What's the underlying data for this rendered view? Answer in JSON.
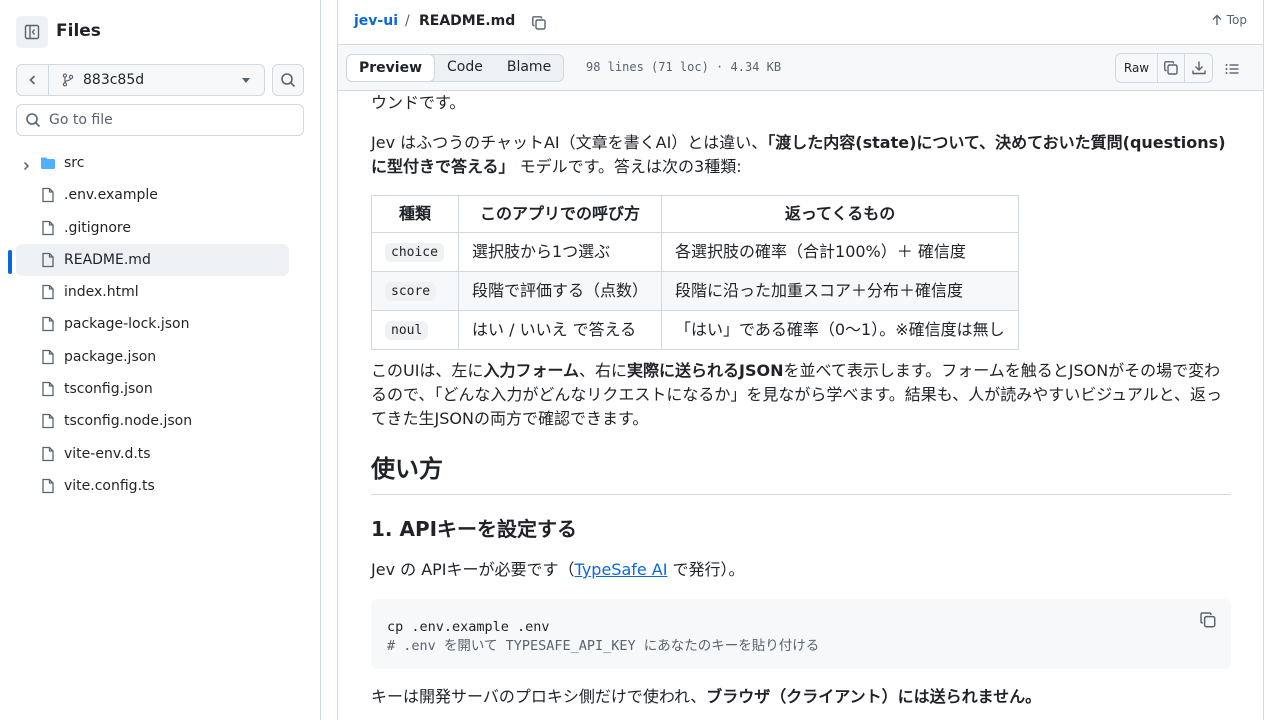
{
  "sidebar": {
    "title": "Files",
    "branch": "883c85d",
    "goto_placeholder": "Go to file",
    "tree": [
      {
        "name": "src",
        "type": "folder"
      },
      {
        "name": ".env.example",
        "type": "file"
      },
      {
        "name": ".gitignore",
        "type": "file"
      },
      {
        "name": "README.md",
        "type": "file",
        "active": true
      },
      {
        "name": "index.html",
        "type": "file"
      },
      {
        "name": "package-lock.json",
        "type": "file"
      },
      {
        "name": "package.json",
        "type": "file"
      },
      {
        "name": "tsconfig.json",
        "type": "file"
      },
      {
        "name": "tsconfig.node.json",
        "type": "file"
      },
      {
        "name": "vite-env.d.ts",
        "type": "file"
      },
      {
        "name": "vite.config.ts",
        "type": "file"
      }
    ]
  },
  "header": {
    "repo": "jev-ui",
    "separator": "/",
    "file": "README.md",
    "top_label": "Top"
  },
  "toolbar": {
    "tabs": [
      "Preview",
      "Code",
      "Blame"
    ],
    "selected_tab": "Preview",
    "meta": "98 lines (71 loc) · 4.34 KB",
    "raw_label": "Raw"
  },
  "readme": {
    "p0": "ウンドです。",
    "p1_a": "Jev はふつうのチャットAI（文章を書くAI）とは違い、",
    "p1_b": "「渡した内容(state)について、決めておいた質問(questions)に型付きで答える」",
    "p1_c": " モデルです。答えは次の3種類:",
    "table": {
      "headers": [
        "種類",
        "このアプリでの呼び方",
        "返ってくるもの"
      ],
      "rows": [
        [
          "choice",
          "選択肢から1つ選ぶ",
          "各選択肢の確率（合計100%）＋ 確信度"
        ],
        [
          "score",
          "段階で評価する（点数）",
          "段階に沿った加重スコア＋分布＋確信度"
        ],
        [
          "noul",
          "はい / いいえ で答える",
          "「はい」である確率（0〜1）。※確信度は無し"
        ]
      ]
    },
    "p2_a": "このUIは、左に",
    "p2_b": "入力フォーム",
    "p2_c": "、右に",
    "p2_d": "実際に送られるJSON",
    "p2_e": "を並べて表示します。フォームを触るとJSONがその場で変わるので、「どんな入力がどんなリクエストになるか」を見ながら学べます。結果も、人が読みやすいビジュアルと、返ってきた生JSONの両方で確認できます。",
    "h2": "使い方",
    "h3": "1. APIキーを設定する",
    "p3_a": "Jev の APIキーが必要です（",
    "p3_link": "TypeSafe AI",
    "p3_b": " で発行）。",
    "code_line1": "cp .env.example .env",
    "code_line2": "# .env を開いて TYPESAFE_API_KEY にあなたのキーを貼り付ける",
    "p4_a": "キーは開発サーバのプロキシ側だけで使われ、",
    "p4_b": "ブラウザ（クライアント）には送られません。"
  }
}
